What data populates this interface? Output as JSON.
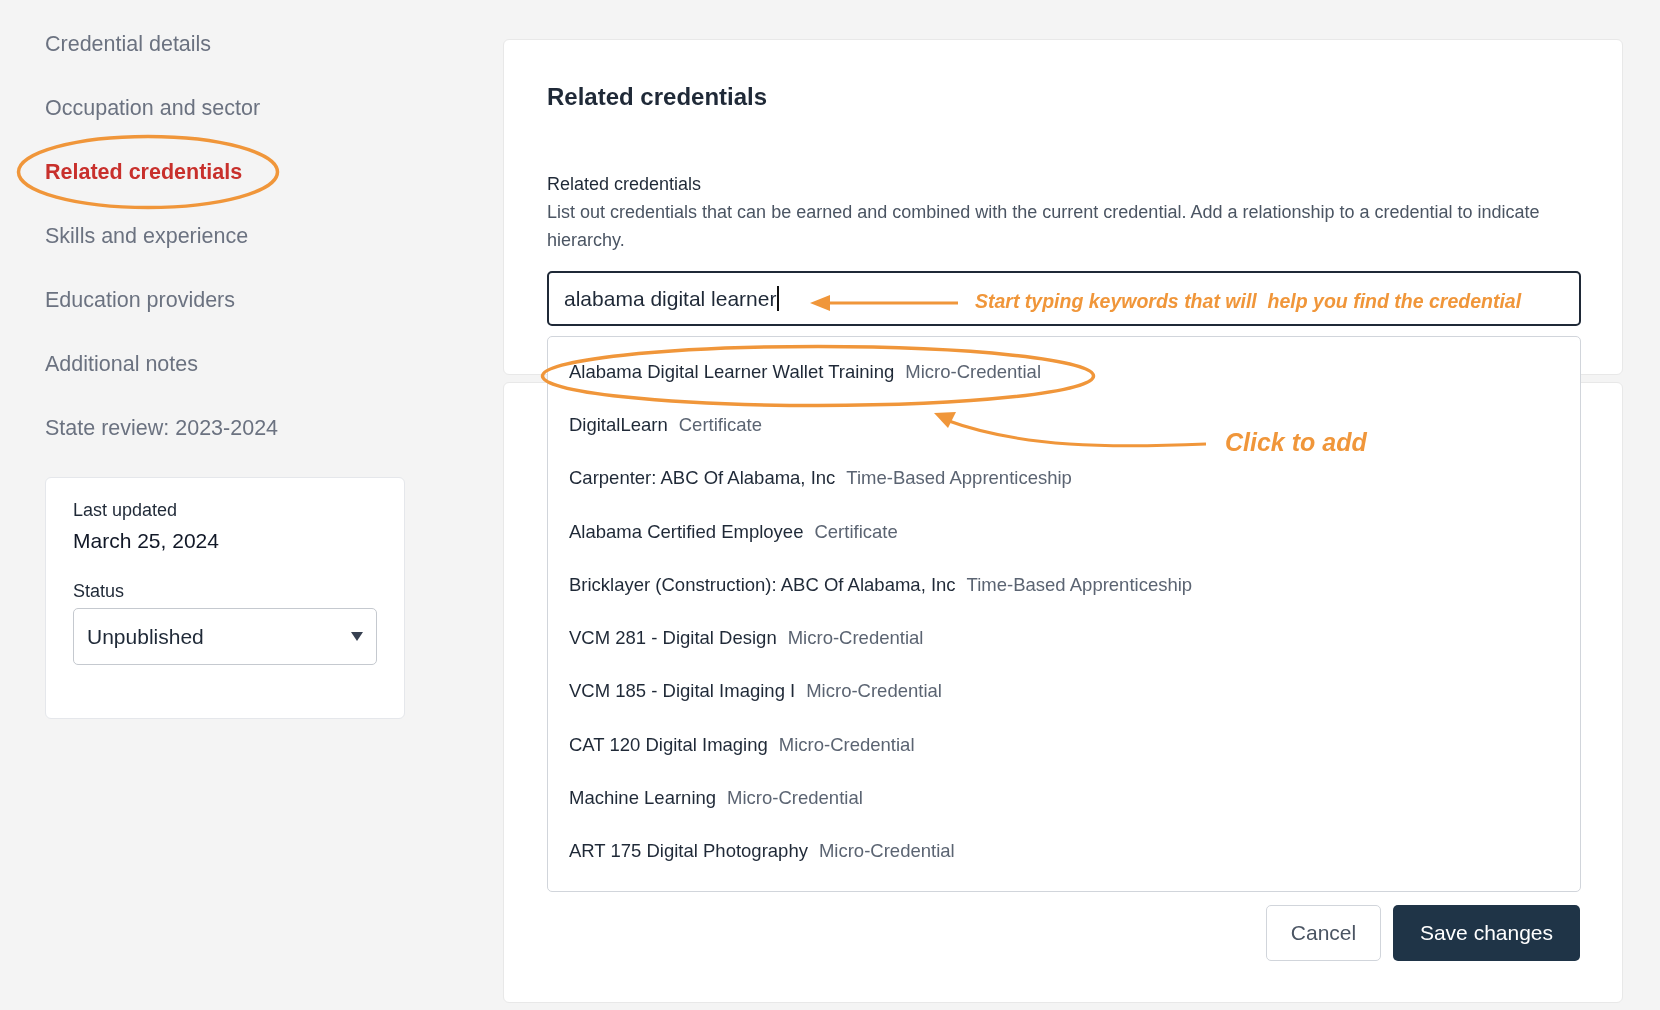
{
  "sidebar": {
    "items": [
      {
        "label": "Credential details",
        "selected": false,
        "circled": false
      },
      {
        "label": "Occupation and sector",
        "selected": false,
        "circled": false
      },
      {
        "label": "Related credentials",
        "selected": true,
        "circled": true
      },
      {
        "label": "Skills and experience",
        "selected": false,
        "circled": false
      },
      {
        "label": "Education providers",
        "selected": false,
        "circled": false
      },
      {
        "label": "Additional notes",
        "selected": false,
        "circled": false
      },
      {
        "label": "State review: 2023-2024",
        "selected": false,
        "circled": false
      }
    ]
  },
  "info_card": {
    "last_updated_label": "Last updated",
    "last_updated": "March 25, 2024",
    "status_label": "Status",
    "status_value": "Unpublished"
  },
  "form": {
    "title": "Related credentials",
    "field_label": "Related credentials",
    "description": "List out credentials that can be earned and combined with the current credential. Add a relationship to a credential to indicate hierarchy.",
    "search_value": "alabama digital learner",
    "suggestions": [
      {
        "name": "Alabama Digital Learner Wallet Training",
        "type": "Micro-Credential",
        "circled": true
      },
      {
        "name": "DigitalLearn",
        "type": "Certificate",
        "circled": false
      },
      {
        "name": "Carpenter: ABC Of Alabama, Inc",
        "type": "Time-Based Apprenticeship",
        "circled": false
      },
      {
        "name": "Alabama Certified Employee",
        "type": "Certificate",
        "circled": false
      },
      {
        "name": "Bricklayer (Construction): ABC Of Alabama, Inc",
        "type": "Time-Based Apprenticeship",
        "circled": false
      },
      {
        "name": "VCM 281 - Digital Design",
        "type": "Micro-Credential",
        "circled": false
      },
      {
        "name": "VCM 185 - Digital Imaging I",
        "type": "Micro-Credential",
        "circled": false
      },
      {
        "name": "CAT 120 Digital Imaging",
        "type": "Micro-Credential",
        "circled": false
      },
      {
        "name": "Machine Learning",
        "type": "Micro-Credential",
        "circled": false
      },
      {
        "name": "ART 175 Digital Photography",
        "type": "Micro-Credential",
        "circled": false
      }
    ],
    "buttons": [
      {
        "label": "Cancel",
        "kind": "secondary"
      },
      {
        "label": "Save changes",
        "kind": "primary"
      }
    ]
  },
  "annotations": [
    {
      "kind": "input-hint",
      "text": "Start typing keywords that will  help you find the credential"
    },
    {
      "kind": "click-hint",
      "text": "Click to add"
    }
  ]
}
